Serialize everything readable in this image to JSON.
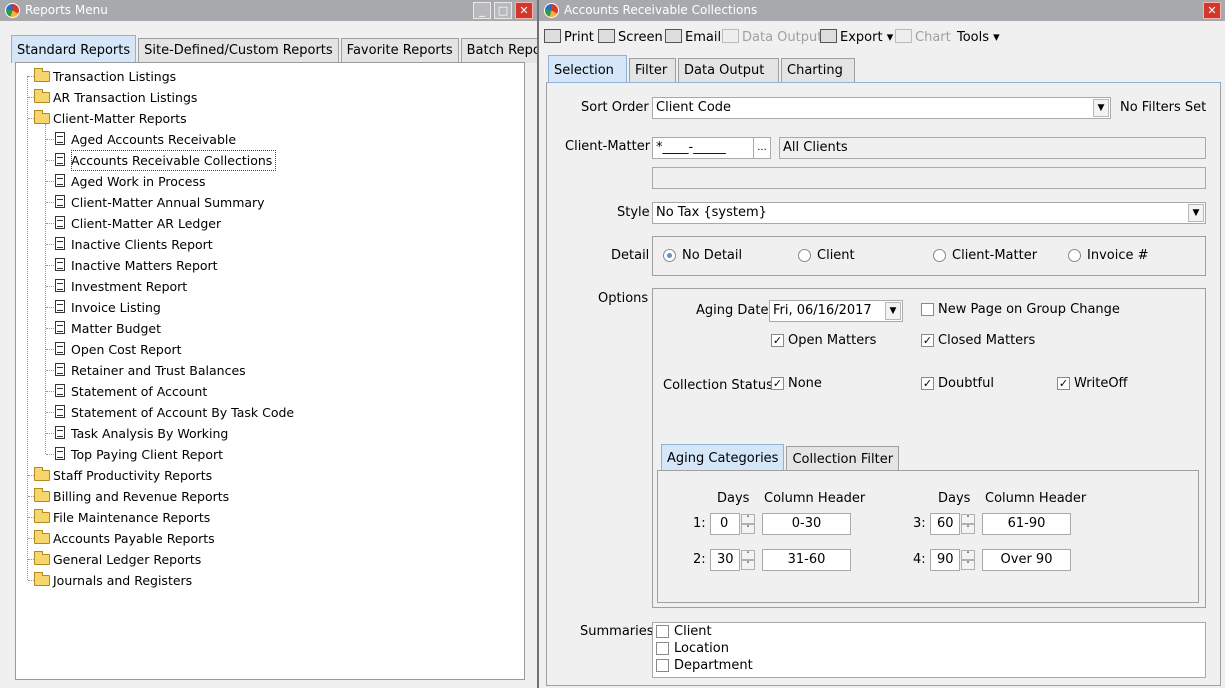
{
  "left_window": {
    "title": "Reports Menu",
    "tabs": [
      "Standard Reports",
      "Site-Defined/Custom Reports",
      "Favorite Reports",
      "Batch Reports"
    ],
    "tree": [
      {
        "label": "Transaction Listings",
        "type": "folder",
        "level": 0
      },
      {
        "label": "AR Transaction Listings",
        "type": "folder",
        "level": 0
      },
      {
        "label": "Client-Matter Reports",
        "type": "folder",
        "level": 0
      },
      {
        "label": "Aged Accounts Receivable",
        "type": "doc",
        "level": 1
      },
      {
        "label": "Accounts Receivable Collections",
        "type": "doc",
        "level": 1,
        "selected": true
      },
      {
        "label": "Aged Work in Process",
        "type": "doc",
        "level": 1
      },
      {
        "label": "Client-Matter Annual Summary",
        "type": "doc",
        "level": 1
      },
      {
        "label": "Client-Matter AR Ledger",
        "type": "doc",
        "level": 1
      },
      {
        "label": "Inactive Clients Report",
        "type": "doc",
        "level": 1
      },
      {
        "label": "Inactive Matters Report",
        "type": "doc",
        "level": 1
      },
      {
        "label": "Investment Report",
        "type": "doc",
        "level": 1
      },
      {
        "label": "Invoice Listing",
        "type": "doc",
        "level": 1
      },
      {
        "label": "Matter Budget",
        "type": "doc",
        "level": 1
      },
      {
        "label": "Open Cost Report",
        "type": "doc",
        "level": 1
      },
      {
        "label": "Retainer and Trust Balances",
        "type": "doc",
        "level": 1
      },
      {
        "label": "Statement of Account",
        "type": "doc",
        "level": 1
      },
      {
        "label": "Statement of Account By Task Code",
        "type": "doc",
        "level": 1
      },
      {
        "label": "Task Analysis By Working",
        "type": "doc",
        "level": 1
      },
      {
        "label": "Top Paying Client Report",
        "type": "doc",
        "level": 1
      },
      {
        "label": "Staff Productivity Reports",
        "type": "folder",
        "level": 0
      },
      {
        "label": "Billing and Revenue Reports",
        "type": "folder",
        "level": 0
      },
      {
        "label": "File Maintenance Reports",
        "type": "folder",
        "level": 0
      },
      {
        "label": "Accounts Payable Reports",
        "type": "folder",
        "level": 0
      },
      {
        "label": "General Ledger Reports",
        "type": "folder",
        "level": 0
      },
      {
        "label": "Journals and Registers",
        "type": "folder",
        "level": 0
      }
    ]
  },
  "right_window": {
    "title": "Accounts Receivable Collections",
    "toolbar": {
      "print": "Print",
      "screen": "Screen",
      "email": "Email",
      "data_output": "Data Output",
      "export": "Export",
      "chart": "Chart",
      "tools": "Tools"
    },
    "tabs": [
      "Selection",
      "Filter",
      "Data Output",
      "Charting"
    ],
    "sort_order_label": "Sort Order",
    "sort_order_value": "Client Code",
    "no_filters": "No Filters Set",
    "client_matter_label": "Client-Matter",
    "client_matter_value": "*____-_____",
    "client_matter_browse": "...",
    "client_matter_desc": "All Clients",
    "style_label": "Style",
    "style_value": "No Tax {system}",
    "detail_label": "Detail",
    "detail_options": [
      "No Detail",
      "Client",
      "Client-Matter",
      "Invoice #"
    ],
    "options_label": "Options",
    "aging_date_label": "Aging Date",
    "aging_date_value": "Fri, 06/16/2017",
    "new_page_label": "New Page on Group Change",
    "open_matters_label": "Open Matters",
    "closed_matters_label": "Closed Matters",
    "collection_status_label": "Collection Status:",
    "status_none": "None",
    "status_doubtful": "Doubtful",
    "status_writeoff": "WriteOff",
    "sub_tabs": [
      "Aging Categories",
      "Collection Filter"
    ],
    "days_header": "Days",
    "column_header_label": "Column Header",
    "aging": [
      {
        "num": "1:",
        "days": "0",
        "header": "0-30"
      },
      {
        "num": "2:",
        "days": "30",
        "header": "31-60"
      },
      {
        "num": "3:",
        "days": "60",
        "header": "61-90"
      },
      {
        "num": "4:",
        "days": "90",
        "header": "Over 90"
      }
    ],
    "summaries_label": "Summaries",
    "summaries": [
      "Client",
      "Location",
      "Department"
    ]
  }
}
